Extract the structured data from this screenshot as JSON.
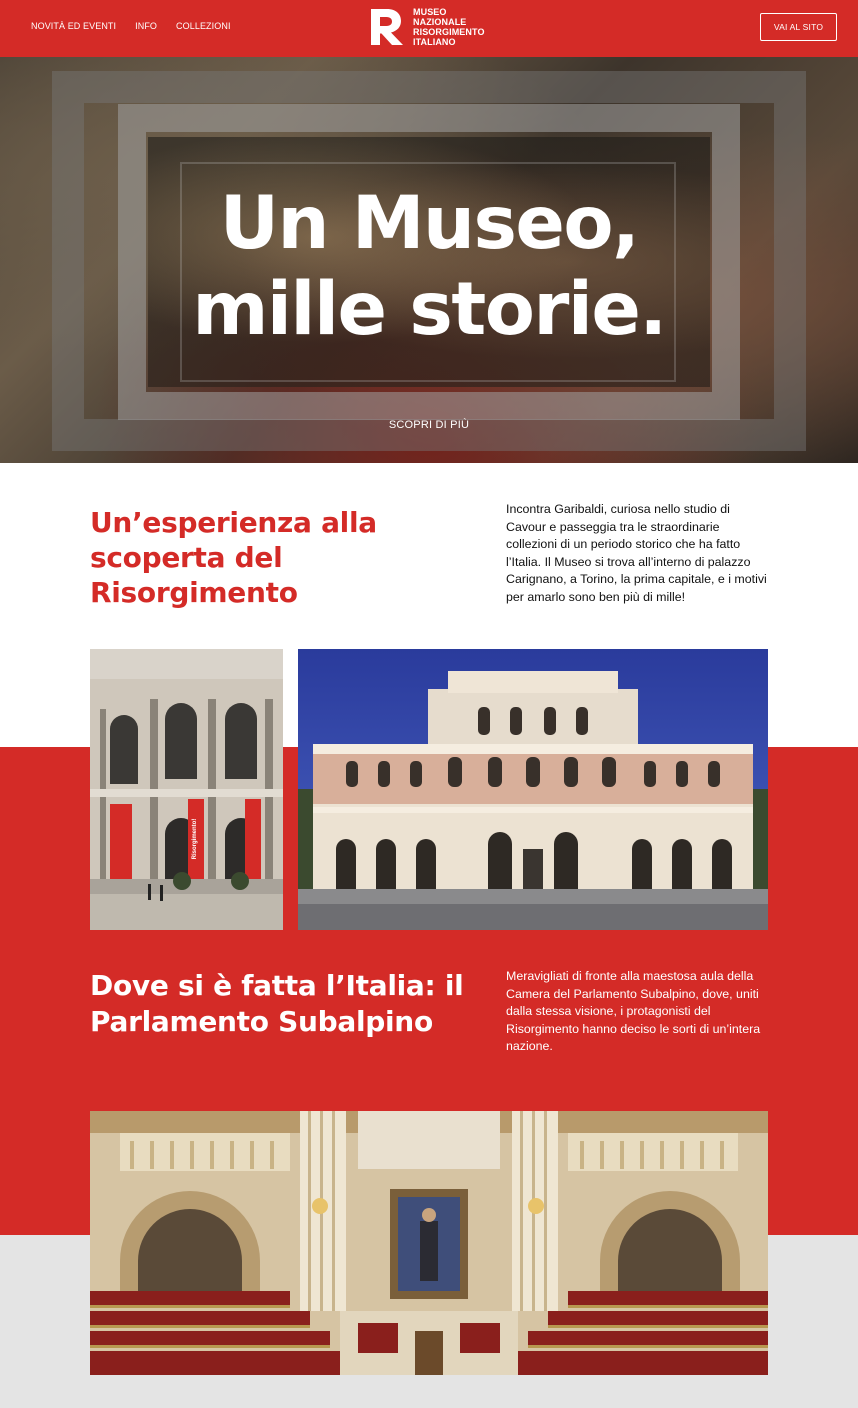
{
  "header": {
    "nav": [
      "NOVITÀ ED EVENTI",
      "INFO",
      "COLLEZIONI"
    ],
    "logo_lines": [
      "MUSEO",
      "NAZIONALE",
      "RISORGIMENTO",
      "ITALIANO"
    ],
    "cta_label": "VAI AL SITO"
  },
  "hero": {
    "title_line1": "Un Museo,",
    "title_line2": "mille storie.",
    "link_label": "SCOPRI DI PIÙ"
  },
  "section1": {
    "title": "Un’esperienza alla scoperta del Risorgimento",
    "text": "Incontra Garibaldi, curiosa nello studio di Cavour e passeggia tra le straordinarie collezioni di un periodo storico che ha fatto l’Italia. Il Museo si trova all’interno di palazzo Carignano, a Torino, la prima capitale, e i motivi per amarlo sono ben più di mille!",
    "banner_text": "Risorgimento!"
  },
  "section2": {
    "title": "Dove si è fatta l’Italia: il Parlamento Subalpino",
    "text": "Meravigliati di fronte alla maestosa aula della Camera del Parlamento Subalpino, dove, uniti dalla stessa visione, i protagonisti del Risorgimento hanno deciso le sorti di un’intera nazione."
  },
  "colors": {
    "brand_red": "#d42b27",
    "light_grey": "#e4e4e4",
    "white": "#ffffff"
  }
}
